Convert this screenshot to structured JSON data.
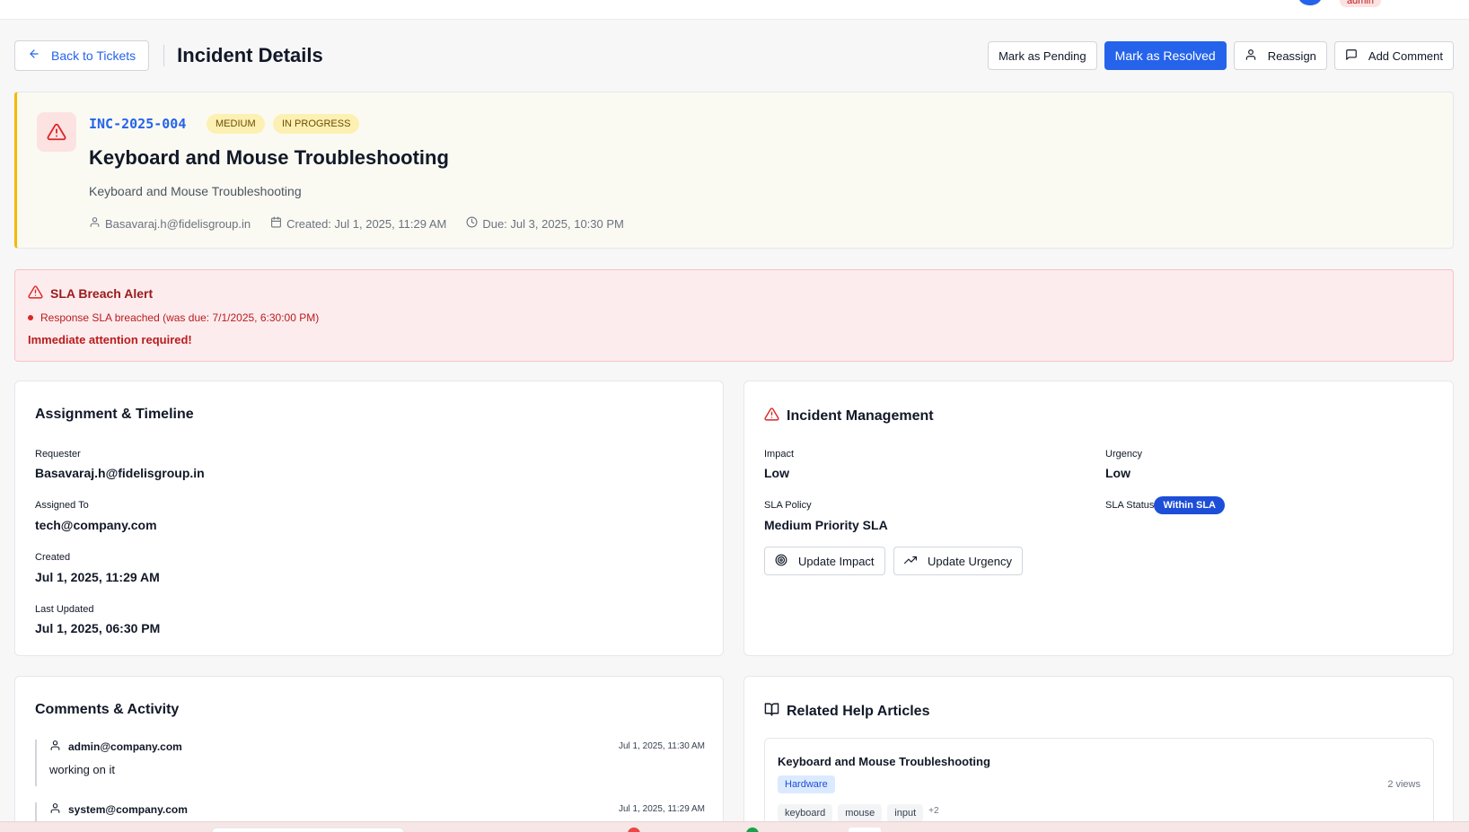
{
  "topbar": {
    "role": "admin"
  },
  "header": {
    "back_label": "Back to Tickets",
    "title": "Incident Details",
    "actions": {
      "pending": "Mark as Pending",
      "resolved": "Mark as Resolved",
      "reassign": "Reassign",
      "comment": "Add Comment"
    }
  },
  "incident": {
    "id": "INC-2025-004",
    "priority": "MEDIUM",
    "status": "IN PROGRESS",
    "title": "Keyboard and Mouse Troubleshooting",
    "description": "Keyboard and Mouse Troubleshooting",
    "requester": "Basavaraj.h@fidelisgroup.in",
    "created": "Created: Jul 1, 2025, 11:29 AM",
    "due": "Due: Jul 3, 2025, 10:30 PM"
  },
  "sla_alert": {
    "title": "SLA Breach Alert",
    "message": "Response SLA breached (was due: 7/1/2025, 6:30:00 PM)",
    "urgent": "Immediate attention required!"
  },
  "assignment": {
    "title": "Assignment & Timeline",
    "requester_label": "Requester",
    "requester": "Basavaraj.h@fidelisgroup.in",
    "assigned_label": "Assigned To",
    "assigned": "tech@company.com",
    "created_label": "Created",
    "created": "Jul 1, 2025, 11:29 AM",
    "updated_label": "Last Updated",
    "updated": "Jul 1, 2025, 06:30 PM"
  },
  "management": {
    "title": "Incident Management",
    "impact_label": "Impact",
    "impact": "Low",
    "urgency_label": "Urgency",
    "urgency": "Low",
    "sla_policy_label": "SLA Policy",
    "sla_policy": "Medium Priority SLA",
    "sla_status_label": "SLA Status",
    "sla_status": "Within SLA",
    "update_impact": "Update Impact",
    "update_urgency": "Update Urgency"
  },
  "comments": {
    "title": "Comments & Activity",
    "items": [
      {
        "author": "admin@company.com",
        "time": "Jul 1, 2025, 11:30 AM",
        "body": "working on it"
      },
      {
        "author": "system@company.com",
        "time": "Jul 1, 2025, 11:29 AM",
        "body": ""
      }
    ]
  },
  "articles": {
    "title": "Related Help Articles",
    "items": [
      {
        "title": "Keyboard and Mouse Troubleshooting",
        "category": "Hardware",
        "views": "2 views",
        "tags": [
          "keyboard",
          "mouse",
          "input"
        ],
        "more": "+2"
      }
    ]
  },
  "colors": {
    "primary": "#2563eb",
    "alert_bg": "#fdecee",
    "alert_text": "#b91c1c",
    "priority_badge": "#fdf0b3",
    "accent_border": "#f5b800"
  },
  "icons": [
    "arrow-left-icon",
    "user-icon",
    "message-square-icon",
    "alert-triangle-icon",
    "calendar-icon",
    "clock-icon",
    "target-icon",
    "trending-up-icon",
    "book-open-icon"
  ]
}
